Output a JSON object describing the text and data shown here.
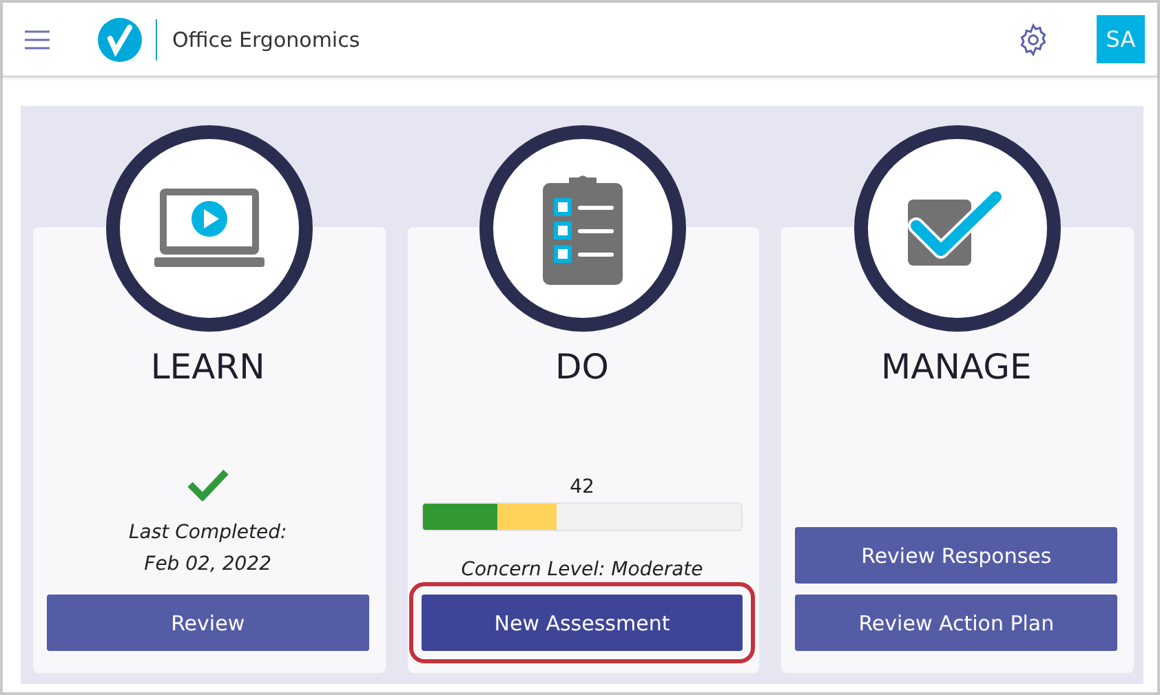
{
  "header": {
    "title": "Office Ergonomics",
    "avatar": "SA"
  },
  "cards": [
    {
      "title": "LEARN",
      "completed": true,
      "status_lines": [
        "Last Completed:",
        "Feb 02, 2022"
      ],
      "buttons": [
        {
          "label": "Review",
          "highlighted": false
        }
      ]
    },
    {
      "title": "DO",
      "progress": {
        "reading": "42",
        "level": 0.42,
        "color": "#ffd25a",
        "base": {
          "color": "#339933",
          "level": 0.235
        }
      },
      "concern": "Concern Level: Moderate",
      "buttons": [
        {
          "label": "New Assessment",
          "highlighted": true
        }
      ]
    },
    {
      "title": "MANAGE",
      "buttons": [
        {
          "label": "Review Responses",
          "highlighted": false
        },
        {
          "label": "Review Action Plan",
          "highlighted": false
        }
      ]
    }
  ]
}
